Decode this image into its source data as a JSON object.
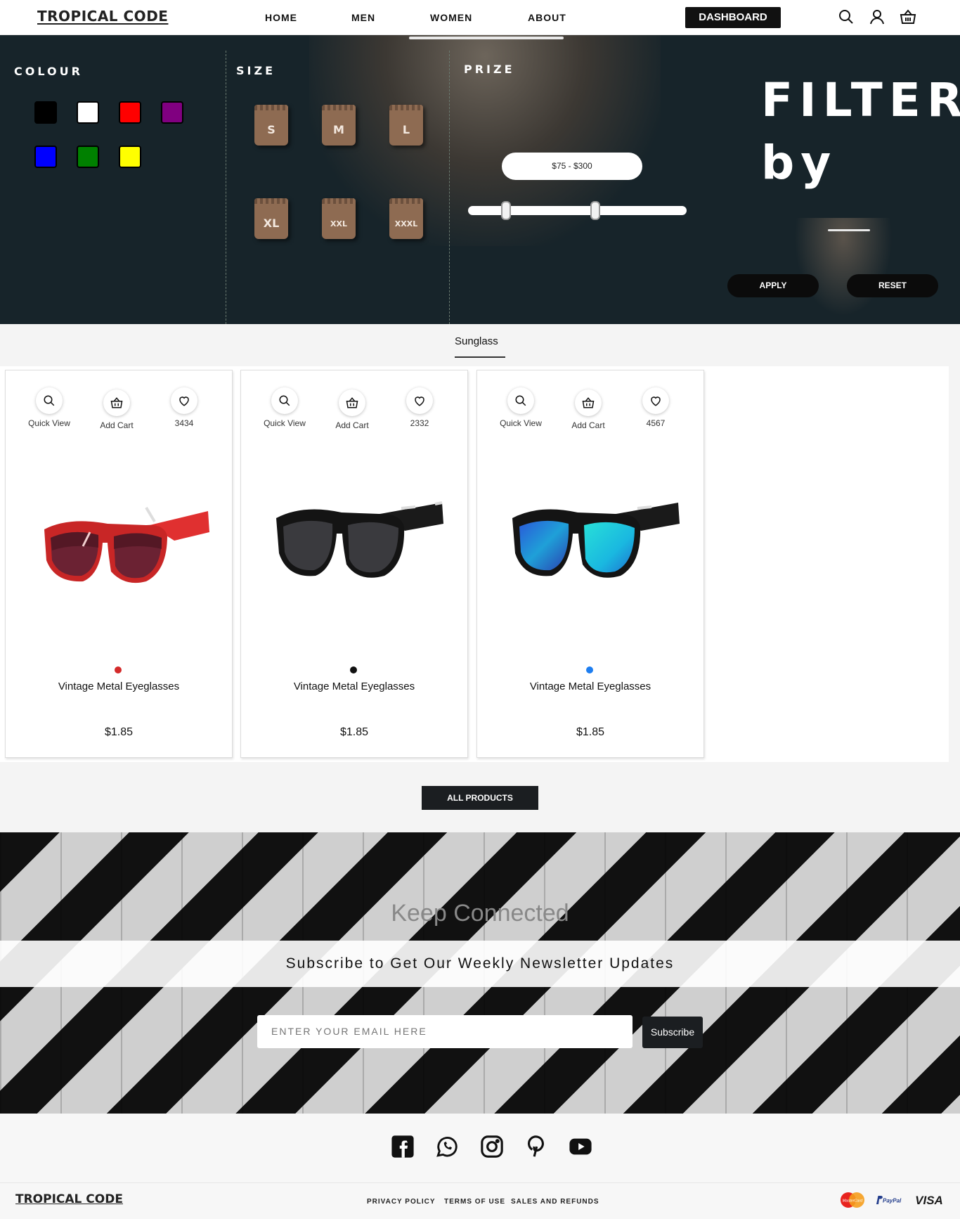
{
  "brand": "TROPICAL CODE",
  "nav": {
    "links": [
      "HOME",
      "MEN",
      "WOMEN",
      "ABOUT"
    ],
    "dashboard": "DASHBOARD",
    "icons": [
      "search-icon",
      "user-icon",
      "basket-icon"
    ]
  },
  "filter": {
    "colour_label": "COLOUR",
    "colours": [
      "#000000",
      "#ffffff",
      "#ff0000",
      "#800080",
      "#0000ff",
      "#008000",
      "#ffff00"
    ],
    "size_label": "SIZE",
    "sizes": [
      "S",
      "M",
      "L",
      "XL",
      "XXL",
      "XXXL"
    ],
    "price_label": "PRIZE",
    "price_range": "$75 - $300",
    "price_min": 75,
    "price_max": 300,
    "title_line1": "FILTER",
    "title_line2": "by",
    "apply": "APPLY",
    "reset": "RESET"
  },
  "category": "Sunglass",
  "products": [
    {
      "quick_view": "Quick View",
      "add_cart": "Add Cart",
      "likes": "3434",
      "color": "#d42a2a",
      "name": "Vintage Metal Eyeglasses",
      "price": "$1.85"
    },
    {
      "quick_view": "Quick View",
      "add_cart": "Add Cart",
      "likes": "2332",
      "color": "#111111",
      "name": "Vintage Metal Eyeglasses",
      "price": "$1.85"
    },
    {
      "quick_view": "Quick View",
      "add_cart": "Add Cart",
      "likes": "4567",
      "color": "#1e7ef0",
      "name": "Vintage Metal Eyeglasses",
      "price": "$1.85"
    }
  ],
  "all_products": "ALL PRODUCTS",
  "newsletter": {
    "heading": "Keep Connected",
    "subheading": "Subscribe to Get Our Weekly Newsletter Updates",
    "placeholder": "ENTER YOUR EMAIL HERE",
    "button": "Subscribe"
  },
  "footer": {
    "social": [
      "facebook-icon",
      "whatsapp-icon",
      "instagram-icon",
      "pinterest-icon",
      "youtube-icon"
    ],
    "links": [
      "PRIVACY POLICY",
      "TERMS OF USE",
      "SALES AND REFUNDS"
    ],
    "payments": [
      "MasterCard",
      "PayPal",
      "VISA"
    ]
  }
}
